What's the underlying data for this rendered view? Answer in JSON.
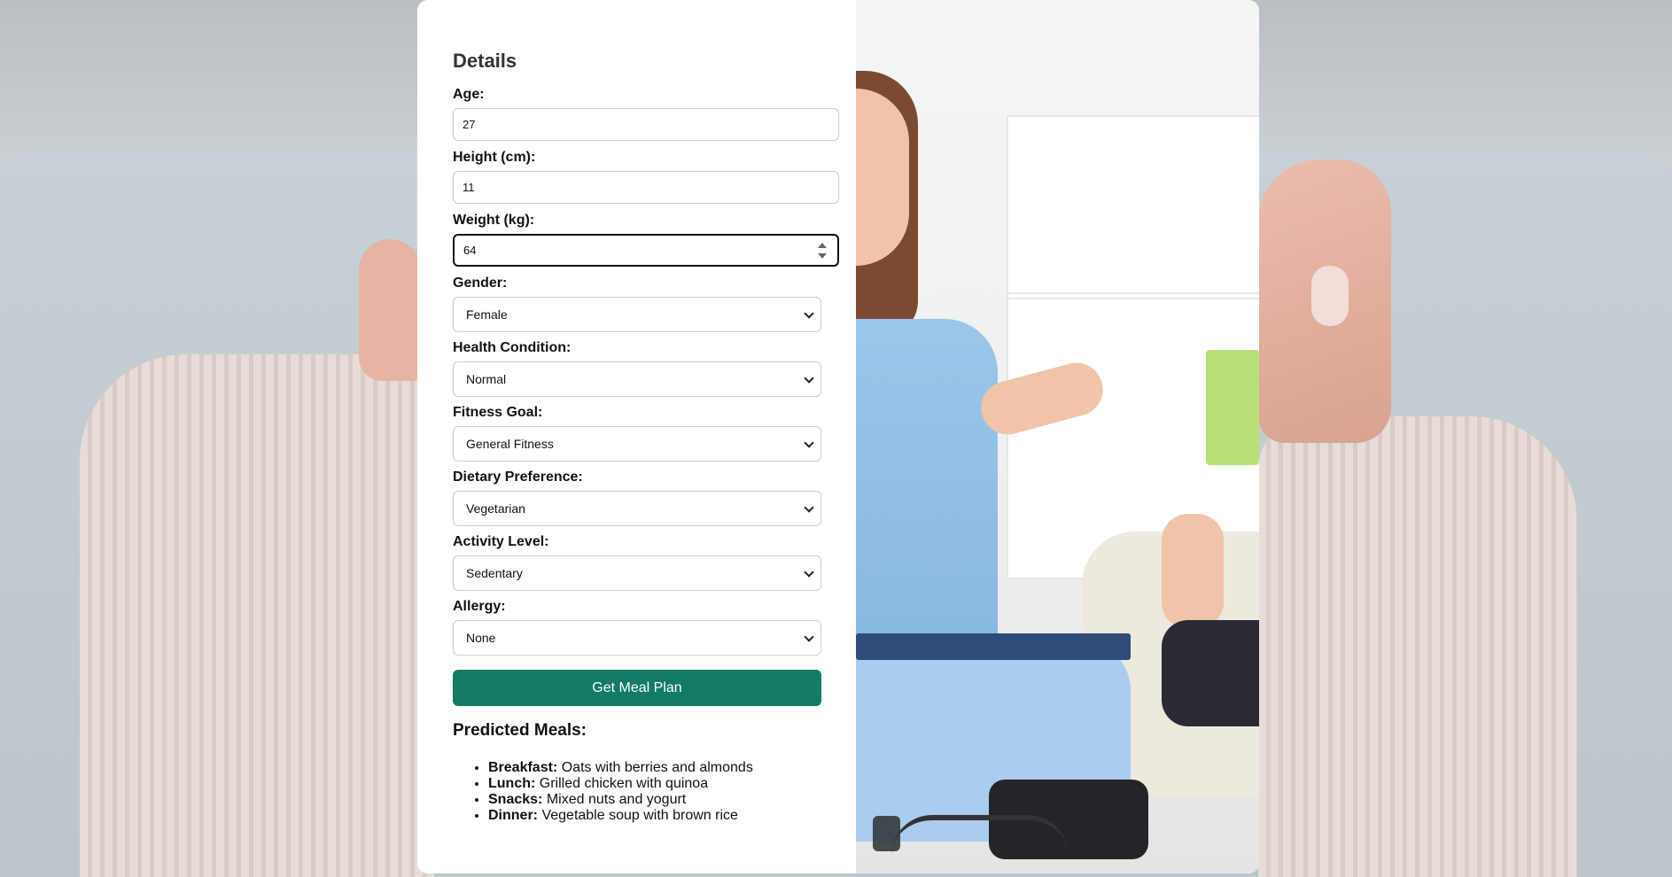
{
  "form": {
    "heading": "Details",
    "fields": [
      {
        "label": "Age:",
        "value": "27"
      },
      {
        "label": "Height (cm):",
        "value": "11"
      },
      {
        "label": "Weight (kg):",
        "value": "64"
      }
    ],
    "selects": [
      {
        "label": "Gender:",
        "value": "Female"
      },
      {
        "label": "Health Condition:",
        "value": "Normal"
      },
      {
        "label": "Fitness Goal:",
        "value": "General Fitness"
      },
      {
        "label": "Dietary Preference:",
        "value": "Vegetarian"
      },
      {
        "label": "Activity Level:",
        "value": "Sedentary"
      },
      {
        "label": "Allergy:",
        "value": "None"
      }
    ],
    "submit_label": "Get Meal Plan"
  },
  "results": {
    "title": "Predicted Meals:",
    "meals": [
      {
        "name": "Breakfast:",
        "item": "Oats with berries and almonds"
      },
      {
        "name": "Lunch:",
        "item": "Grilled chicken with quinoa"
      },
      {
        "name": "Snacks:",
        "item": "Mixed nuts and yogurt"
      },
      {
        "name": "Dinner:",
        "item": "Vegetable soup with brown rice"
      }
    ]
  },
  "colors": {
    "accent": "#137a63",
    "card_background": "#ffffff",
    "page_background": "#c3ccd0"
  },
  "icons": {
    "select_arrow": "chevron-down-icon",
    "number_spinner": "spinner-arrows-icon"
  }
}
